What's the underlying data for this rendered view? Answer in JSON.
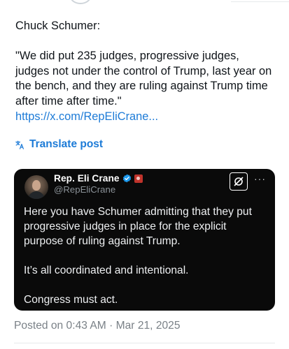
{
  "post": {
    "author_line": "Chuck Schumer:",
    "quote": "\"We did put 235 judges, progressive judges, judges not under the control of Trump, last year on the bench, and they are ruling against Trump time after time after time.\"",
    "link": "https://x.com/RepEliCrane..."
  },
  "translate": {
    "label": "Translate post",
    "icon": "translate-icon"
  },
  "quoted_post": {
    "name": "Rep. Eli Crane",
    "handle": "@RepEliCrane",
    "verified_icon": "verified-badge-icon",
    "affiliation_icon": "government-flag-icon",
    "paragraphs": [
      "Here you have Schumer admitting that they put progressive judges in place for the explicit purpose of ruling against Trump.",
      "It’s all coordinated and intentional.",
      "Congress must act."
    ],
    "more_label": "···"
  },
  "footer": {
    "posted": "Posted on 0:43 AM · Mar 21, 2025"
  },
  "colors": {
    "link": "#1d7bd7",
    "card_bg": "#0a0a0a",
    "muted": "#7a8187",
    "verified": "#1d9bf0"
  }
}
